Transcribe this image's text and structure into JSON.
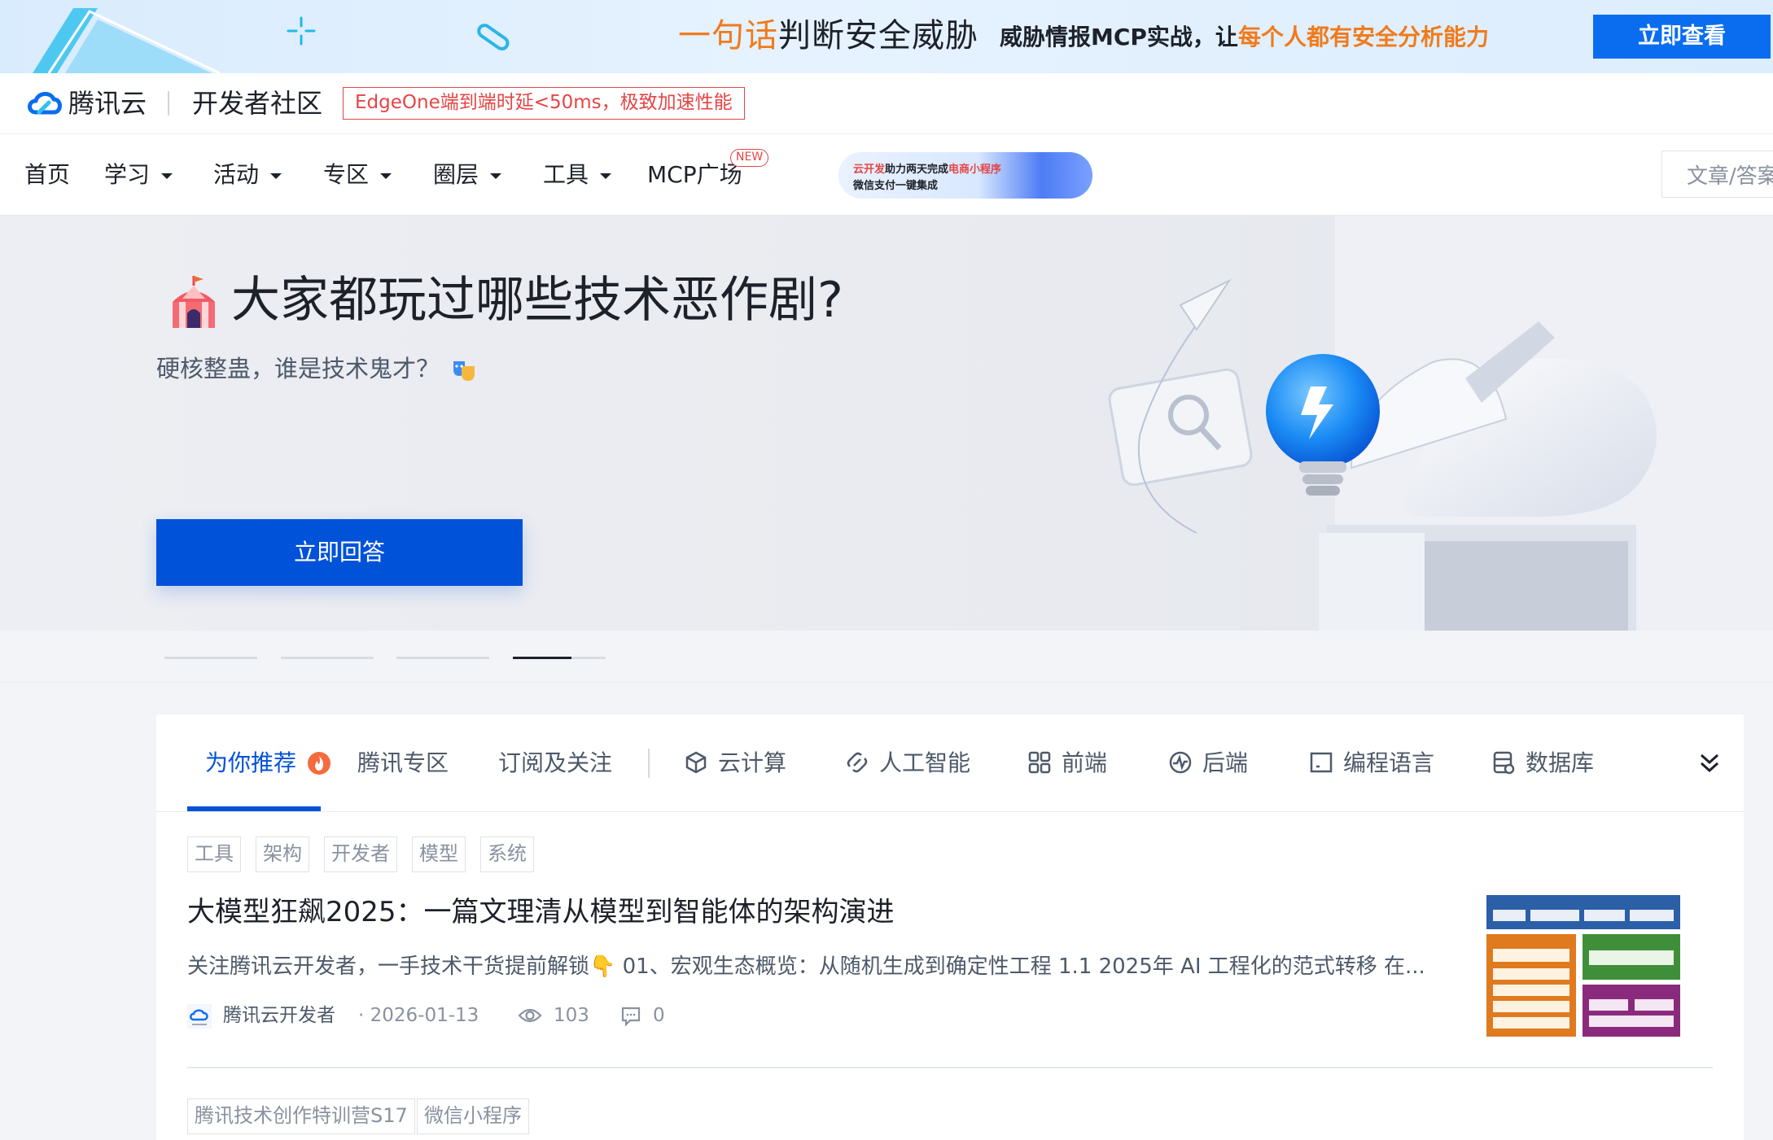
{
  "promo": {
    "headline_orange": "一句话",
    "headline_dark": "判断安全威胁",
    "sub_dark": "威胁情报MCP实战，让",
    "sub_orange": "每个人都有安全分析能力",
    "cta": "立即查看",
    "accent": "#f07b1c",
    "cta_color": "#0a6df0"
  },
  "header": {
    "logo": "腾讯云",
    "community": "开发者社区",
    "edge_notice": "EdgeOne端到端时延<50ms，极致加速性能"
  },
  "nav": {
    "items": [
      {
        "label": "首页",
        "has_dropdown": false
      },
      {
        "label": "学习",
        "has_dropdown": true
      },
      {
        "label": "活动",
        "has_dropdown": true
      },
      {
        "label": "专区",
        "has_dropdown": true
      },
      {
        "label": "圈层",
        "has_dropdown": true
      },
      {
        "label": "工具",
        "has_dropdown": true
      },
      {
        "label": "MCP广场",
        "has_dropdown": false
      }
    ],
    "new_badge": "NEW",
    "mini_banner": {
      "line1_a": "云开发",
      "line1_b": "助力两天完成",
      "line1_c": "电商小程序",
      "line2": "微信支付一键集成"
    },
    "search_placeholder": "文章/答案"
  },
  "hero": {
    "title": "大家都玩过哪些技术恶作剧?",
    "subtitle": "硬核整蛊，谁是技术鬼才？",
    "button": "立即回答",
    "carousel_count": 4,
    "carousel_active": 4
  },
  "feed": {
    "tabs": [
      {
        "label": "为你推荐",
        "icon": "fire-icon",
        "active": true
      },
      {
        "label": "腾讯专区",
        "icon": "",
        "active": false
      },
      {
        "label": "订阅及关注",
        "icon": "",
        "active": false
      },
      {
        "label": "云计算",
        "icon": "cube-icon",
        "active": false
      },
      {
        "label": "人工智能",
        "icon": "ai-icon",
        "active": false
      },
      {
        "label": "前端",
        "icon": "frontend-icon",
        "active": false
      },
      {
        "label": "后端",
        "icon": "backend-icon",
        "active": false
      },
      {
        "label": "编程语言",
        "icon": "code-icon",
        "active": false
      },
      {
        "label": "数据库",
        "icon": "database-icon",
        "active": false
      }
    ],
    "article1": {
      "tags": [
        "工具",
        "架构",
        "开发者",
        "模型",
        "系统"
      ],
      "title": "大模型狂飙2025：一篇文理清从模型到智能体的架构演进",
      "summary": "关注腾讯云开发者，一手技术干货提前解锁👇 01、宏观生态概览：从随机生成到确定性工程 1.1 2025年 AI 工程化的范式转移 在...",
      "author": "腾讯云开发者",
      "date": "· 2026-01-13",
      "views": "103",
      "comments": "0"
    },
    "article2": {
      "tags": [
        "腾讯技术创作特训营S17",
        "微信小程序"
      ]
    }
  }
}
